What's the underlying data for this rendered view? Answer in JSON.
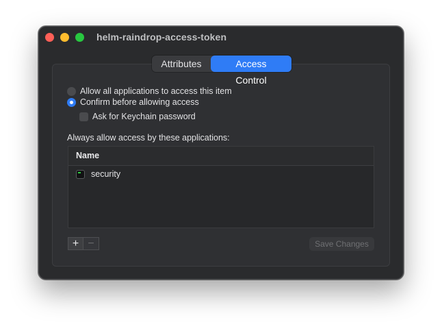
{
  "window": {
    "title": "helm-raindrop-access-token"
  },
  "tabs": [
    {
      "label": "Attributes",
      "active": false
    },
    {
      "label": "Access Control",
      "active": true
    }
  ],
  "access": {
    "option_allow_all": "Allow all applications to access this item",
    "option_confirm": "Confirm before allowing access",
    "selected": "confirm",
    "ask_keychain_password": "Ask for Keychain password",
    "ask_keychain_checked": false,
    "section_label": "Always allow access by these applications:"
  },
  "apps_table": {
    "column_name": "Name",
    "rows": [
      {
        "name": "security",
        "icon": "terminal-app-icon"
      }
    ]
  },
  "controls": {
    "add": "+",
    "remove": "−",
    "save_label": "Save Changes"
  },
  "colors": {
    "accent": "#2f7cf6",
    "window_bg": "#2a2b2d"
  }
}
